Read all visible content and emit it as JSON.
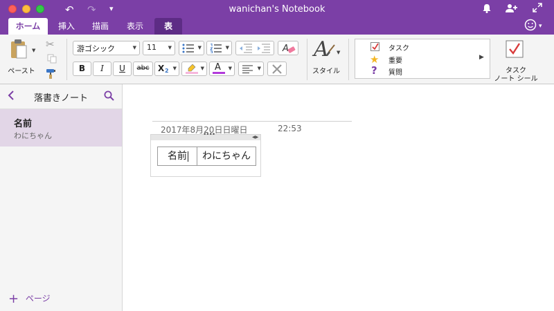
{
  "window": {
    "title": "wanichan's Notebook"
  },
  "tabs": [
    {
      "label": "ホーム",
      "active": true
    },
    {
      "label": "挿入"
    },
    {
      "label": "描画"
    },
    {
      "label": "表示"
    },
    {
      "label": "表",
      "context": true
    }
  ],
  "ribbon": {
    "paste_label": "ペースト",
    "font_name": "游ゴシック",
    "font_size": "11",
    "bold": "B",
    "italic": "I",
    "underline": "U",
    "strike": "abc",
    "subscript": "X",
    "subscript_mark": "2",
    "font_color_glyph": "A",
    "styles_label": "スタイル",
    "style_glyph": "A",
    "tags": [
      {
        "label": "タスク",
        "icon": "checkbox-icon"
      },
      {
        "label": "重要",
        "icon": "star-icon"
      },
      {
        "label": "質問",
        "icon": "question-icon"
      }
    ],
    "task_tag_label_1": "タスク",
    "task_tag_label_2": "ノート シール"
  },
  "colors": {
    "accent": "#7b3fa6",
    "highlight": "#f7b6dc",
    "font_color": "#b23adb",
    "selected_page": "#e2d6e7"
  },
  "left_panel": {
    "section_title": "落書きノート",
    "pages": [
      {
        "title": "名前",
        "subtitle": "わにちゃん"
      }
    ],
    "add_page_label": "ページ"
  },
  "page": {
    "date": "2017年8月20日日曜日",
    "time": "22:53",
    "table": {
      "cells": [
        "名前",
        "わにちゃん"
      ]
    }
  }
}
